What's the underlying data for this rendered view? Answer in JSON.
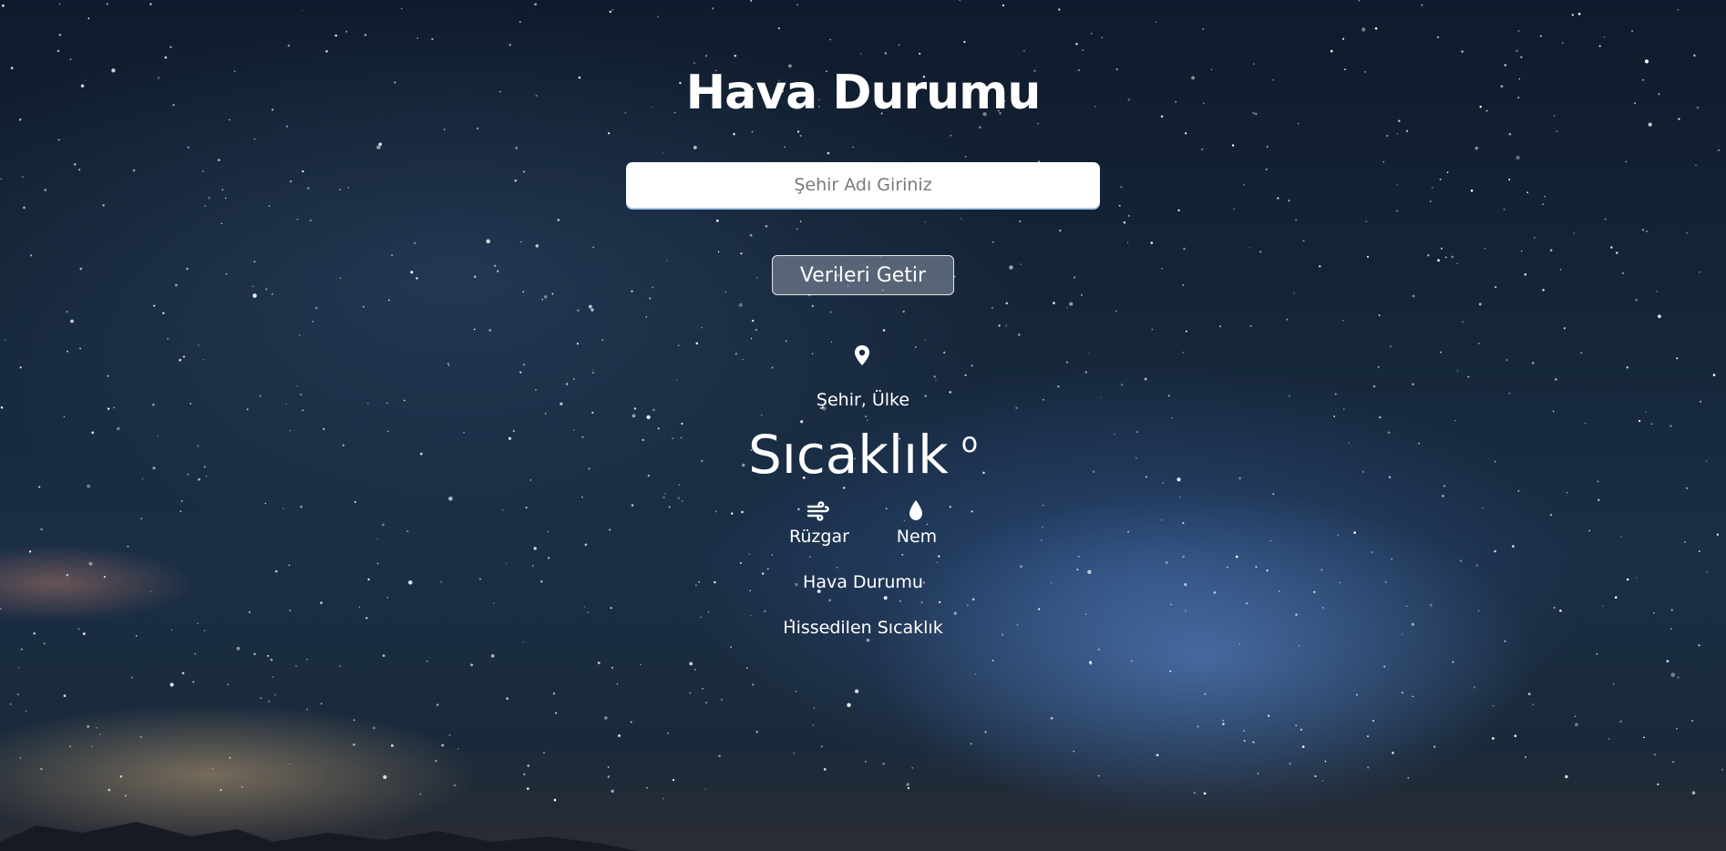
{
  "header": {
    "title": "Hava Durumu"
  },
  "search": {
    "placeholder": "Şehir Adı Giriniz",
    "value": ""
  },
  "actions": {
    "fetch_label": "Verileri Getir"
  },
  "weather": {
    "location": "Şehir, Ülke",
    "temperature": "Sıcaklık",
    "degree_symbol": "o",
    "wind_label": "Rüzgar",
    "humidity_label": "Nem",
    "condition": "Hava Durumu",
    "feels_like": "Hissedilen Sıcaklık"
  },
  "icons": {
    "location": "map-pin-icon",
    "wind": "wind-icon",
    "humidity": "water-drop-icon"
  },
  "colors": {
    "text": "#ffffff",
    "input_background": "#ffffff",
    "input_underline": "#a8c8e6",
    "button_background": "rgba(140,150,165,0.55)",
    "button_border": "#e6e6e6",
    "sky_dark": "#0f1b2c",
    "milky_way": "#608cd2"
  }
}
